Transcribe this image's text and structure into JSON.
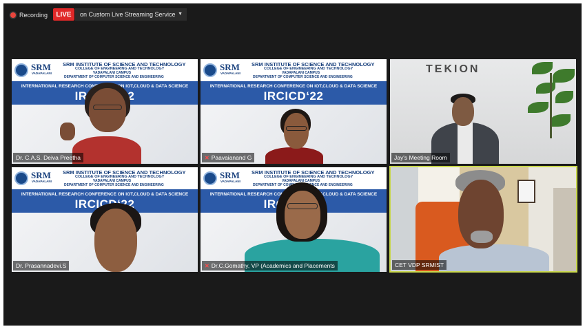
{
  "topbar": {
    "recording_label": "Recording",
    "live_label": "LIVE",
    "stream_service": "on Custom Live Streaming Service",
    "dropdown_caret": "▼"
  },
  "banner": {
    "logo": "SRM",
    "logo_sub": "VADAPALANI",
    "institute": "SRM INSTITUTE OF SCIENCE AND TECHNOLOGY",
    "college": "COLLEGE OF ENGINEERING AND TECHNOLOGY",
    "campus": "VADAPALANI CAMPUS",
    "department": "DEPARTMENT OF COMPUTER SCIENCE AND ENGINEERING",
    "conference": "INTERNATIONAL RESEARCH CONFERENCE ON IOT,CLOUD & DATA SCIENCE",
    "code": "IRCICD‘22"
  },
  "room": {
    "brand": "TEKION"
  },
  "participants": [
    {
      "name": "Dr. C.A.S. Deiva Preetha",
      "muted": false
    },
    {
      "name": "Paavaianand G",
      "muted": true
    },
    {
      "name": "Jay's Meeting Room",
      "muted": false
    },
    {
      "name": "Dr. Prasannadevi.S",
      "muted": false
    },
    {
      "name": "Dr.C.Gomathy, VP (Academics and Placements",
      "muted": true
    },
    {
      "name": "CET VDP SRMIST",
      "muted": false
    }
  ],
  "icons": {
    "recording": "record-dot-icon",
    "mic_off": "mic-off-icon"
  },
  "colors": {
    "live": "#e02828",
    "active_speaker": "#c9d84c",
    "banner_blue": "#2c5aa8"
  }
}
